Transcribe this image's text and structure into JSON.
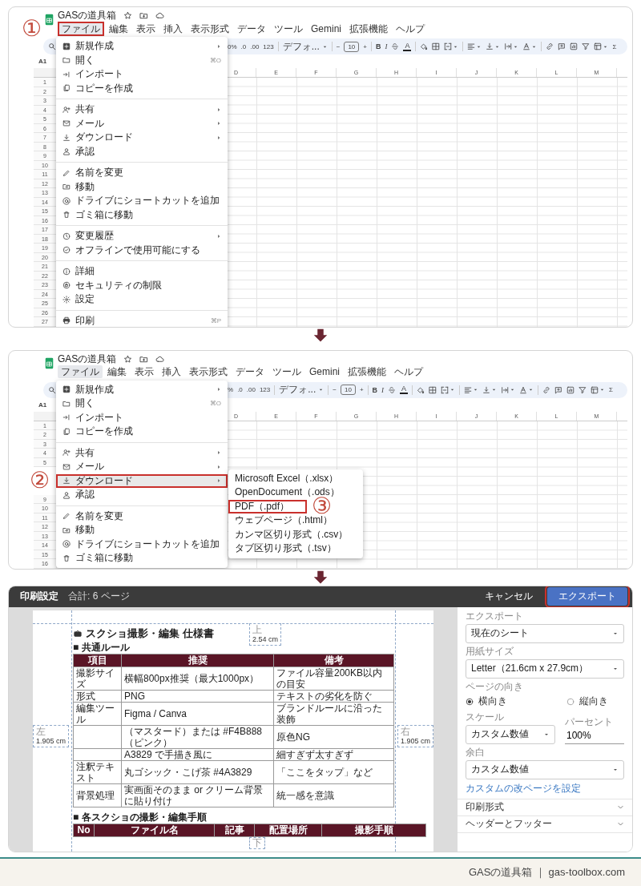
{
  "panels": [
    {
      "kind": "sheet",
      "doc_title": "GASの道具箱",
      "menu_bar": [
        {
          "label": "ファイル",
          "selected": true,
          "marked": true,
          "step": "①"
        },
        {
          "label": "編集",
          "selected": false,
          "marked": false
        },
        {
          "label": "表示",
          "selected": false,
          "marked": false
        },
        {
          "label": "挿入",
          "selected": false,
          "marked": false
        },
        {
          "label": "表示形式",
          "selected": false,
          "marked": false
        },
        {
          "label": "データ",
          "selected": false,
          "marked": false
        },
        {
          "label": "ツール",
          "selected": false,
          "marked": false
        },
        {
          "label": "Gemini",
          "selected": false,
          "marked": false
        },
        {
          "label": "拡張機能",
          "selected": false,
          "marked": false
        },
        {
          "label": "ヘルプ",
          "selected": false,
          "marked": false
        }
      ],
      "toolbar": {
        "percent": "0%",
        "decrease_decimals": ".0",
        "increase_decimals": ".00",
        "number_format": "123",
        "font": "デフォ...",
        "size_minus": "−",
        "font_size": "10",
        "size_plus": "+",
        "bold": "B",
        "italic": "I",
        "text_color": "A",
        "sum": "Σ"
      },
      "name_box": "A1",
      "columns": [
        "D",
        "E",
        "F",
        "G",
        "H",
        "I",
        "J",
        "K",
        "L",
        "M"
      ],
      "rows": [
        "1",
        "2",
        "3",
        "4",
        "5",
        "6",
        "7",
        "8",
        "9",
        "10",
        "11",
        "12",
        "13",
        "14",
        "15",
        "16",
        "17",
        "18",
        "19",
        "20",
        "21",
        "22",
        "23",
        "24",
        "25",
        "26",
        "27"
      ],
      "file_menu": {
        "groups": [
          {
            "items": [
              {
                "kind": "new",
                "label": "新規作成",
                "submenu": true,
                "selected": false,
                "marked": false
              },
              {
                "kind": "open",
                "label": "開く",
                "shortcut": "⌘O",
                "submenu": false,
                "selected": false,
                "marked": false
              },
              {
                "kind": "import",
                "label": "インポート",
                "submenu": false,
                "selected": false,
                "marked": false
              },
              {
                "kind": "copy",
                "label": "コピーを作成",
                "submenu": false,
                "selected": false,
                "marked": false
              }
            ]
          },
          {
            "items": [
              {
                "kind": "share",
                "label": "共有",
                "submenu": true,
                "selected": false,
                "marked": false
              },
              {
                "kind": "email",
                "label": "メール",
                "submenu": true,
                "selected": false,
                "marked": false
              },
              {
                "kind": "download",
                "label": "ダウンロード",
                "submenu": true,
                "selected": false,
                "marked": false
              },
              {
                "kind": "approvals",
                "label": "承認",
                "submenu": false,
                "selected": false,
                "marked": false
              }
            ]
          },
          {
            "items": [
              {
                "kind": "rename",
                "label": "名前を変更",
                "submenu": false,
                "selected": false,
                "marked": false
              },
              {
                "kind": "move",
                "label": "移動",
                "submenu": false,
                "selected": false,
                "marked": false
              },
              {
                "kind": "shortcut",
                "label": "ドライブにショートカットを追加",
                "submenu": false,
                "selected": false,
                "marked": false
              },
              {
                "kind": "trash",
                "label": "ゴミ箱に移動",
                "submenu": false,
                "selected": false,
                "marked": false
              }
            ]
          },
          {
            "items": [
              {
                "kind": "history",
                "label": "変更履歴",
                "submenu": true,
                "selected": false,
                "marked": false
              },
              {
                "kind": "offline",
                "label": "オフラインで使用可能にする",
                "submenu": false,
                "selected": false,
                "marked": false
              }
            ]
          },
          {
            "items": [
              {
                "kind": "details",
                "label": "詳細",
                "submenu": false,
                "selected": false,
                "marked": false
              },
              {
                "kind": "security",
                "label": "セキュリティの制限",
                "submenu": false,
                "selected": false,
                "marked": false
              },
              {
                "kind": "settings",
                "label": "設定",
                "submenu": false,
                "selected": false,
                "marked": false
              }
            ]
          },
          {
            "items": [
              {
                "kind": "print",
                "label": "印刷",
                "shortcut": "⌘P",
                "submenu": false,
                "selected": false,
                "marked": false
              }
            ]
          }
        ]
      }
    },
    {
      "kind": "sheet",
      "doc_title": "GASの道具箱",
      "menu_bar": [
        {
          "label": "ファイル",
          "selected": true,
          "marked": false
        },
        {
          "label": "編集",
          "selected": false,
          "marked": false
        },
        {
          "label": "表示",
          "selected": false,
          "marked": false
        },
        {
          "label": "挿入",
          "selected": false,
          "marked": false
        },
        {
          "label": "表示形式",
          "selected": false,
          "marked": false
        },
        {
          "label": "データ",
          "selected": false,
          "marked": false
        },
        {
          "label": "ツール",
          "selected": false,
          "marked": false
        },
        {
          "label": "Gemini",
          "selected": false,
          "marked": false
        },
        {
          "label": "拡張機能",
          "selected": false,
          "marked": false
        },
        {
          "label": "ヘルプ",
          "selected": false,
          "marked": false
        }
      ],
      "toolbar": {
        "percent": "%",
        "decrease_decimals": ".0",
        "increase_decimals": ".00",
        "number_format": "123",
        "font": "デフォ...",
        "size_minus": "−",
        "font_size": "10",
        "size_plus": "+",
        "bold": "B",
        "italic": "I",
        "text_color": "A",
        "sum": "Σ"
      },
      "name_box": "A1",
      "columns": [
        "D",
        "E",
        "F",
        "G",
        "H",
        "I",
        "J",
        "K",
        "L",
        "M"
      ],
      "rows": [
        "1",
        "2",
        "3",
        "4",
        "5"
      ],
      "rows_after_gap": [
        "9",
        "10",
        "11",
        "12",
        "13",
        "14",
        "15",
        "16"
      ],
      "file_menu": {
        "groups": [
          {
            "items": [
              {
                "kind": "new",
                "label": "新規作成",
                "submenu": true,
                "selected": false,
                "marked": false
              },
              {
                "kind": "open",
                "label": "開く",
                "shortcut": "⌘O",
                "submenu": false,
                "selected": false,
                "marked": false
              },
              {
                "kind": "import",
                "label": "インポート",
                "submenu": false,
                "selected": false,
                "marked": false
              },
              {
                "kind": "copy",
                "label": "コピーを作成",
                "submenu": false,
                "selected": false,
                "marked": false
              }
            ]
          },
          {
            "items": [
              {
                "kind": "share",
                "label": "共有",
                "submenu": true,
                "selected": false,
                "marked": false
              },
              {
                "kind": "email",
                "label": "メール",
                "submenu": true,
                "selected": false,
                "marked": false
              },
              {
                "kind": "download",
                "label": "ダウンロード",
                "submenu": true,
                "selected": true,
                "marked": true,
                "step": "②",
                "submenu_items": [
                  {
                    "label": "Microsoft Excel（.xlsx）",
                    "selected": false,
                    "marked": false
                  },
                  {
                    "label": "OpenDocument（.ods）",
                    "selected": false,
                    "marked": false
                  },
                  {
                    "label": "PDF（.pdf）",
                    "selected": false,
                    "marked": true,
                    "step": "③"
                  },
                  {
                    "label": "ウェブページ（.html）",
                    "selected": false,
                    "marked": false
                  },
                  {
                    "label": "カンマ区切り形式（.csv）",
                    "selected": false,
                    "marked": false
                  },
                  {
                    "label": "タブ区切り形式（.tsv）",
                    "selected": false,
                    "marked": false
                  }
                ]
              },
              {
                "kind": "approvals",
                "label": "承認",
                "submenu": false,
                "selected": false,
                "marked": false
              }
            ]
          },
          {
            "items": [
              {
                "kind": "rename",
                "label": "名前を変更",
                "submenu": false,
                "selected": false,
                "marked": false
              },
              {
                "kind": "move",
                "label": "移動",
                "submenu": false,
                "selected": false,
                "marked": false
              },
              {
                "kind": "shortcut",
                "label": "ドライブにショートカットを追加",
                "submenu": false,
                "selected": false,
                "marked": false
              },
              {
                "kind": "trash",
                "label": "ゴミ箱に移動",
                "submenu": false,
                "selected": false,
                "marked": false
              }
            ]
          }
        ]
      }
    },
    {
      "kind": "print",
      "title": "印刷設定",
      "page_count": "合計: 6 ページ",
      "cancel": "キャンセル",
      "export": {
        "label": "エクスポート",
        "marked": true
      },
      "preview": {
        "heading": "スクショ撮影・編集 仕様書",
        "section_1": "■ 共通ルール",
        "table_1": {
          "columns": [
            "項目",
            "推奨",
            "備考"
          ],
          "rows": [
            {
              "item": "撮影サイズ",
              "recommended": "横幅800px推奨（最大1000px）",
              "note": "ファイル容量200KB以内の目安"
            },
            {
              "item": "形式",
              "recommended": "PNG",
              "note": "テキストの劣化を防ぐ"
            },
            {
              "item": "編集ツール",
              "recommended": "Figma / Canva",
              "note": "ブランドルールに沿った装飾"
            },
            {
              "recommended": "（マスタード）または #F4B888（ピンク）",
              "note": "原色NG"
            },
            {
              "recommended": "A3829 で手描き風に",
              "note": "細すぎず太すぎず"
            },
            {
              "item": "注釈テキスト",
              "recommended": "丸ゴシック・こげ茶 #4A3829",
              "note": "「ここをタップ」など"
            },
            {
              "item": "背景処理",
              "recommended": "実画面そのまま or クリーム背景に貼り付け",
              "note": "統一感を意識"
            }
          ]
        },
        "section_2": "■ 各スクショの撮影・編集手順",
        "table_2": {
          "columns": [
            "No",
            "ファイル名",
            "記事",
            "配置場所",
            "撮影手順"
          ]
        },
        "margins": {
          "top": {
            "label": "上",
            "value": "2.54 cm"
          },
          "left": {
            "label": "左",
            "value": "1.905 cm"
          },
          "right": {
            "label": "右",
            "value": "1.905 cm"
          },
          "bottom": {
            "label": "下"
          }
        }
      },
      "settings": {
        "export_label": "エクスポート",
        "export_value": "現在のシート",
        "paper_label": "用紙サイズ",
        "paper_value": "Letter（21.6cm x 27.9cm）",
        "orientation_label": "ページの向き",
        "orientations": [
          {
            "label": "横向き",
            "selected": true
          },
          {
            "label": "縦向き",
            "selected": false
          }
        ],
        "scale_label": "スケール",
        "scale_value": "カスタム数値",
        "percent_label": "パーセント",
        "percent_value": "100%",
        "margin_label": "余白",
        "margin_value": "カスタム数値",
        "page_break_link": "カスタムの改ページを設定",
        "sections": [
          {
            "label": "印刷形式",
            "expanded": false
          },
          {
            "label": "ヘッダーとフッター",
            "expanded": false
          }
        ]
      }
    }
  ],
  "footer": "GASの道具箱 ｜ gas-toolbox.com"
}
